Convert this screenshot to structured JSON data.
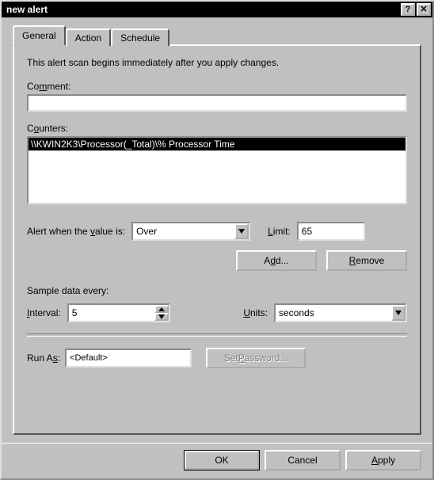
{
  "window": {
    "title": "new alert"
  },
  "tabs": {
    "general": "General",
    "action": "Action",
    "schedule": "Schedule"
  },
  "intro": "This alert scan begins immediately after you apply changes.",
  "comment": {
    "label": "Comment:",
    "value": ""
  },
  "counters": {
    "label": "Counters:",
    "items": [
      "\\\\KWIN2K3\\Processor(_Total)\\% Processor Time"
    ]
  },
  "alert_when": {
    "label": "Alert when the value is:",
    "condition": "Over",
    "limit_label": "Limit:",
    "limit_value": "65"
  },
  "buttons": {
    "add": "Add...",
    "remove": "Remove",
    "set_password": "Set Password...",
    "ok": "OK",
    "cancel": "Cancel",
    "apply": "Apply"
  },
  "sample": {
    "heading": "Sample data every:",
    "interval_label": "Interval:",
    "interval_value": "5",
    "units_label": "Units:",
    "units_value": "seconds"
  },
  "runas": {
    "label": "Run As:",
    "value": "<Default>"
  }
}
